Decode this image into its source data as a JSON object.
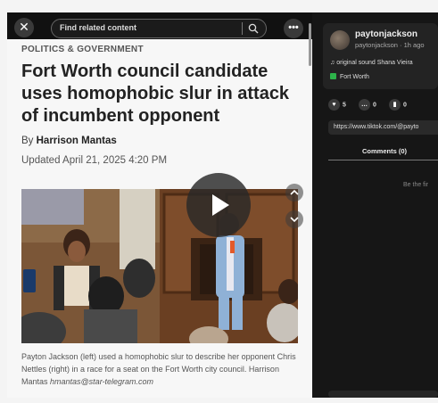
{
  "toolbar": {
    "close_icon": "close-icon",
    "search_placeholder": "Find related content",
    "search_icon": "search-icon",
    "more_icon": "more-icon"
  },
  "article": {
    "kicker": "POLITICS & GOVERNMENT",
    "headline": "Fort Worth council candidate uses homophobic slur in attack of incumbent opponent",
    "by_prefix": "By",
    "author": "Harrison Mantas",
    "updated": "Updated April 21, 2025 4:20 PM",
    "caption": "Payton Jackson (left) used a homophobic slur to describe her opponent Chris Nettles (right) in a race for a seat on the Fort Worth city council. Harrison Mantas",
    "caption_email": "hmantas@star-telegram.com"
  },
  "video": {
    "play_icon": "play-icon",
    "up_icon": "chevron-up-icon",
    "down_icon": "chevron-down-icon"
  },
  "panel": {
    "username": "paytonjackson",
    "handle": "paytonjackson · 1h ago",
    "sound": "original sound   Shana Vieira",
    "location": "Fort Worth",
    "likes": "5",
    "comments_count": "0",
    "saves": "0",
    "url": "https://www.tiktok.com/@payto",
    "comments_tab": "Comments (0)",
    "first_comment_hint": "Be the fir"
  }
}
